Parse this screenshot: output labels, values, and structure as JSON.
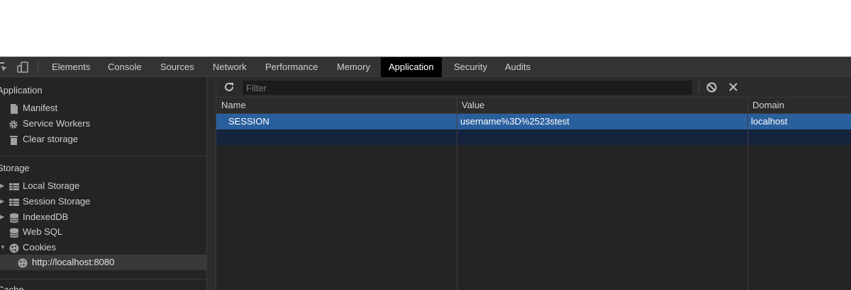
{
  "tabs": [
    "Elements",
    "Console",
    "Sources",
    "Network",
    "Performance",
    "Memory",
    "Application",
    "Security",
    "Audits"
  ],
  "active_tab": "Application",
  "sidebar": {
    "application_title": "Application",
    "application_items": [
      {
        "label": "Manifest",
        "icon": "document-icon"
      },
      {
        "label": "Service Workers",
        "icon": "gear-icon"
      },
      {
        "label": "Clear storage",
        "icon": "trash-icon"
      }
    ],
    "storage_title": "Storage",
    "storage_items": [
      {
        "label": "Local Storage",
        "icon": "grid-icon",
        "expandable": true
      },
      {
        "label": "Session Storage",
        "icon": "grid-icon",
        "expandable": true
      },
      {
        "label": "IndexedDB",
        "icon": "database-icon",
        "expandable": true
      },
      {
        "label": "Web SQL",
        "icon": "database-icon",
        "expandable": false
      },
      {
        "label": "Cookies",
        "icon": "cookie-icon",
        "expanded": true
      }
    ],
    "cookie_child": {
      "label": "http://localhost:8080",
      "icon": "cookie-icon"
    },
    "cache_title": "Cache"
  },
  "toolbar": {
    "filter_placeholder": "Filter",
    "refresh_icon": "refresh-icon",
    "clear_icon": "block-icon",
    "delete_icon": "close-icon"
  },
  "table": {
    "columns": [
      "Name",
      "Value",
      "Domain"
    ],
    "rows": [
      {
        "name": "SESSION",
        "value": "username%3D%2523stest",
        "domain": "localhost"
      }
    ]
  },
  "colors": {
    "background": "#242424",
    "active_tab": "#000000",
    "selected_row": "#2a5f9e",
    "empty_row": "#15233d"
  }
}
